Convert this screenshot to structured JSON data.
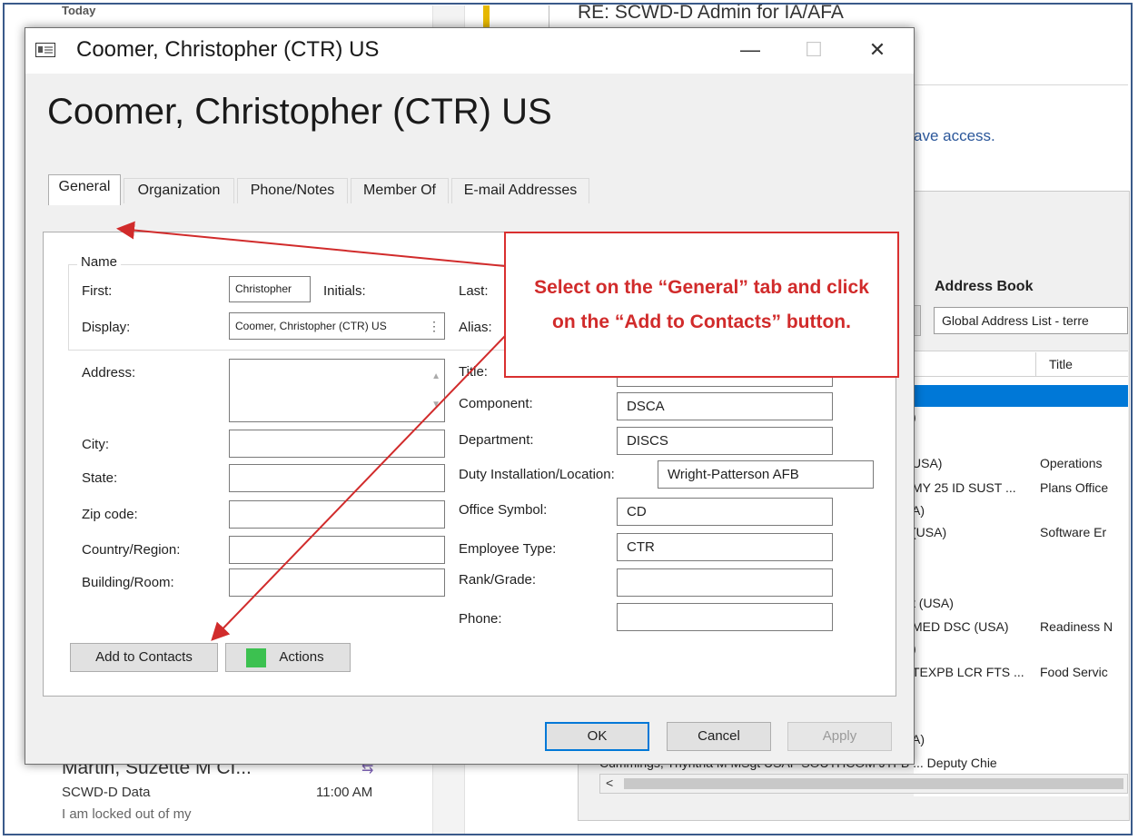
{
  "background": {
    "folder_header": "Today",
    "email_subject": "RE: SCWD-D Admin for IA/AFA",
    "body_fragment": "ave access.",
    "message_list": {
      "sender": "Martin, Suzette M CI...",
      "folder": "SCWD-D Data",
      "time": "11:00 AM",
      "preview": "I am locked out of my"
    },
    "address_book": {
      "label": "Address Book",
      "selected_list": "Global Address List - terre",
      "column_title": "Title",
      "rows": [
        {
          "name": ")",
          "title": ""
        },
        {
          "name": "USA)",
          "title": "Operations"
        },
        {
          "name": "MY 25 ID SUST ...",
          "title": "Plans Office"
        },
        {
          "name": "A)",
          "title": ""
        },
        {
          "name": " (USA)",
          "title": "Software Er"
        },
        {
          "name": "t (USA)",
          "title": ""
        },
        {
          "name": " MED DSC (USA)",
          "title": "Readiness N"
        },
        {
          "name": ")",
          "title": ""
        },
        {
          "name": "TEXPB LCR FTS ...",
          "title": "Food Servic"
        },
        {
          "name": "A)",
          "title": ""
        }
      ],
      "last_row": "Cummings, Thyntria M MSgt USAF SOUTHCOM JTFB ...  Deputy Chie"
    }
  },
  "dialog": {
    "window_title": "Coomer, Christopher (CTR) US",
    "heading": "Coomer, Christopher (CTR) US",
    "window_controls": {
      "minimize": "—",
      "maximize": "☐",
      "close": "✕"
    },
    "tabs": [
      "General",
      "Organization",
      "Phone/Notes",
      "Member Of",
      "E-mail Addresses"
    ],
    "name_group": {
      "legend": "Name",
      "first_label": "First:",
      "first_value": "Christopher",
      "initials_label": "Initials:",
      "last_label": "Last:",
      "display_label": "Display:",
      "display_value": "Coomer, Christopher (CTR) US",
      "alias_label": "Alias:"
    },
    "address": {
      "address_label": "Address:",
      "city_label": "City:",
      "state_label": "State:",
      "zip_label": "Zip code:",
      "country_label": "Country/Region:",
      "building_label": "Building/Room:"
    },
    "org": {
      "title_label": "Title:",
      "component_label": "Component:",
      "component_value": "DSCA",
      "department_label": "Department:",
      "department_value": "DISCS",
      "duty_label": "Duty Installation/Location:",
      "duty_value": "Wright-Patterson AFB",
      "office_label": "Office Symbol:",
      "office_value": "CD",
      "employee_label": "Employee Type:",
      "employee_value": "CTR",
      "rank_label": "Rank/Grade:",
      "phone_label": "Phone:"
    },
    "buttons": {
      "add_contacts": "Add to Contacts",
      "actions": "Actions",
      "ok": "OK",
      "cancel": "Cancel",
      "apply": "Apply"
    }
  },
  "annotation": {
    "callout": "Select on the “General” tab and click on the “Add to Contacts” button.",
    "color": "#d12b2b"
  }
}
